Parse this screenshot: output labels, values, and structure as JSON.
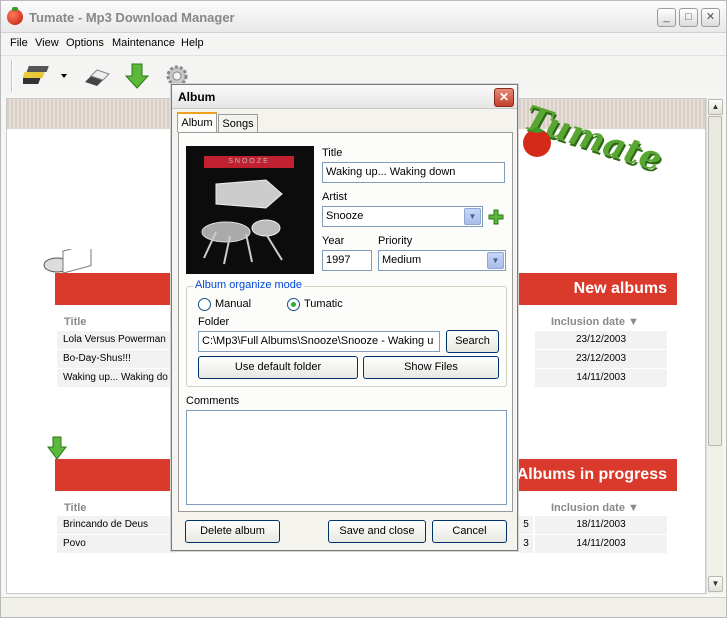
{
  "window": {
    "title": "Tumate - Mp3 Download Manager"
  },
  "menu": [
    "File",
    "View",
    "Options",
    "Maintenance",
    "Help"
  ],
  "toolbar": {
    "icons": [
      "albums-stack-icon",
      "dropdown-arrow-icon",
      "eraser-icon",
      "download-arrow-icon",
      "settings-gear-icon"
    ]
  },
  "main": {
    "logo_text": "Tumate",
    "new_albums": {
      "title": "New albums",
      "col_title": "Title",
      "col_date": "Inclusion date ▼",
      "rows": [
        {
          "title": "Lola Versus Powerman",
          "date": "23/12/2003"
        },
        {
          "title": "Bo-Day-Shus!!!",
          "date": "23/12/2003"
        },
        {
          "title": "Waking up... Waking do",
          "date": "14/11/2003"
        }
      ]
    },
    "in_progress": {
      "title": "Albums in progress",
      "col_title": "Title",
      "col_date": "Inclusion date ▼",
      "rows": [
        {
          "title": "Brincando de Deus",
          "mid": "5",
          "date": "18/11/2003"
        },
        {
          "title": "Povo",
          "mid": "3",
          "date": "14/11/2003"
        }
      ]
    }
  },
  "dialog": {
    "title": "Album",
    "tabs": [
      "Album",
      "Songs"
    ],
    "cover_text": "SNOOZE",
    "title_label": "Title",
    "title_value": "Waking up... Waking down",
    "artist_label": "Artist",
    "artist_value": "Snooze",
    "year_label": "Year",
    "year_value": "1997",
    "priority_label": "Priority",
    "priority_value": "Medium",
    "organize_group": "Album organize mode",
    "mode_manual": "Manual",
    "mode_tumatic": "Tumatic",
    "folder_label": "Folder",
    "folder_value": "C:\\Mp3\\Full Albums\\Snooze\\Snooze - Waking u",
    "search_button": "Search",
    "default_folder_button": "Use default folder",
    "show_files_button": "Show Files",
    "comments_label": "Comments",
    "delete_button": "Delete album",
    "save_button": "Save and close",
    "cancel_button": "Cancel"
  },
  "colors": {
    "band_red": "#d93a2c",
    "logo_green": "#5aa632",
    "accent_orange": "#f0a020"
  }
}
